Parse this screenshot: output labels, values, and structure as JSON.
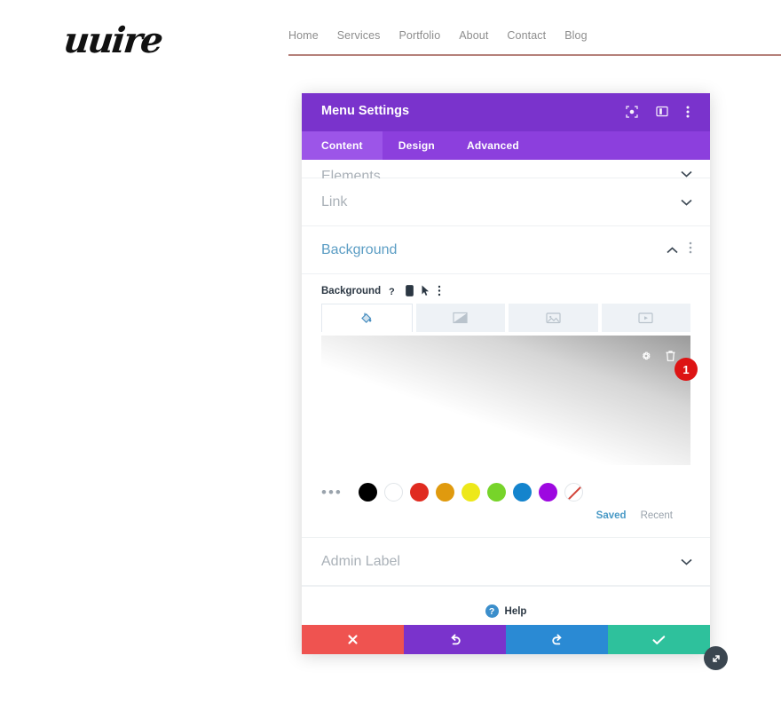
{
  "site": {
    "logo_text": "uuire",
    "nav_items": [
      {
        "label": "Home"
      },
      {
        "label": "Services"
      },
      {
        "label": "Portfolio"
      },
      {
        "label": "About"
      },
      {
        "label": "Contact"
      },
      {
        "label": "Blog"
      }
    ]
  },
  "modal": {
    "title": "Menu Settings",
    "topbar_icons": [
      {
        "name": "fullscreen-icon"
      },
      {
        "name": "layout-panel-icon"
      },
      {
        "name": "more-vertical-icon"
      }
    ],
    "tabs": [
      {
        "label": "Content",
        "active": true
      },
      {
        "label": "Design",
        "active": false
      },
      {
        "label": "Advanced",
        "active": false
      }
    ],
    "sections": [
      {
        "label": "Elements",
        "state": "collapsed"
      },
      {
        "label": "Link",
        "state": "collapsed"
      },
      {
        "label": "Background",
        "state": "expanded"
      },
      {
        "label": "Admin Label",
        "state": "collapsed"
      }
    ],
    "background": {
      "field_label": "Background",
      "field_icons": [
        "help-icon",
        "mobile-icon",
        "hover-cursor-icon",
        "more-vertical-icon"
      ],
      "type_tabs": [
        {
          "name": "background-color-tab",
          "icon": "paint-bucket-icon",
          "active": true
        },
        {
          "name": "background-gradient-tab",
          "icon": "gradient-icon",
          "active": false
        },
        {
          "name": "background-image-tab",
          "icon": "image-icon",
          "active": false
        },
        {
          "name": "background-video-tab",
          "icon": "video-icon",
          "active": false
        }
      ],
      "preview": {
        "gradient_from": "#ffffff",
        "gradient_to": "#9a9a9a",
        "tools": [
          "gear-icon",
          "trash-icon"
        ],
        "badge_count": "1",
        "badge_color": "#dd1414"
      },
      "swatches": [
        {
          "name": "more-colors",
          "color": "dots"
        },
        {
          "name": "black",
          "color": "#000000"
        },
        {
          "name": "white",
          "color": "#ffffff"
        },
        {
          "name": "red",
          "color": "#e02b20"
        },
        {
          "name": "orange",
          "color": "#e09a0e"
        },
        {
          "name": "yellow",
          "color": "#ede81a"
        },
        {
          "name": "green",
          "color": "#77d42a"
        },
        {
          "name": "blue",
          "color": "#1484cd"
        },
        {
          "name": "purple",
          "color": "#9d08e0"
        },
        {
          "name": "none",
          "color": "transparent"
        }
      ],
      "palette_tabs": [
        {
          "label": "Saved",
          "active": true
        },
        {
          "label": "Recent",
          "active": false
        }
      ]
    },
    "help": {
      "label": "Help",
      "icon_glyph": "?"
    },
    "footer_buttons": [
      {
        "name": "cancel-button",
        "icon": "close-icon",
        "color": "#ef5350"
      },
      {
        "name": "undo-button",
        "icon": "undo-icon",
        "color": "#7a33cc"
      },
      {
        "name": "redo-button",
        "icon": "redo-icon",
        "color": "#2a8ad4"
      },
      {
        "name": "save-button",
        "icon": "check-icon",
        "color": "#2ec19c"
      }
    ]
  }
}
